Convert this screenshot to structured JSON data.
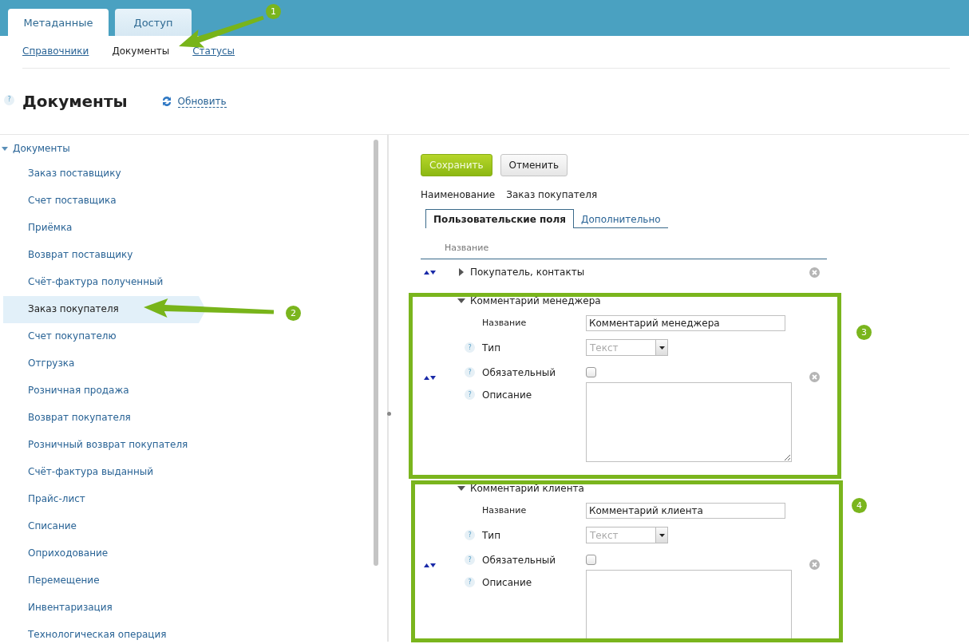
{
  "top_tabs": [
    {
      "label": "Метаданные",
      "selected": true
    },
    {
      "label": "Доступ",
      "selected": false
    }
  ],
  "subnav": [
    {
      "label": "Справочники",
      "selected": false
    },
    {
      "label": "Документы",
      "selected": true
    },
    {
      "label": "Статусы",
      "selected": false
    }
  ],
  "page": {
    "help": "?",
    "title": "Документы",
    "refresh": "Обновить"
  },
  "tree": {
    "label": "Документы",
    "expanded": true,
    "children": [
      {
        "label": "Заказ поставщику",
        "selected": false
      },
      {
        "label": "Счет поставщика",
        "selected": false
      },
      {
        "label": "Приёмка",
        "selected": false
      },
      {
        "label": "Возврат поставщику",
        "selected": false
      },
      {
        "label": "Счёт-фактура полученный",
        "selected": false
      },
      {
        "label": "Заказ покупателя",
        "selected": true
      },
      {
        "label": "Счет покупателю",
        "selected": false
      },
      {
        "label": "Отгрузка",
        "selected": false
      },
      {
        "label": "Розничная продажа",
        "selected": false
      },
      {
        "label": "Возврат покупателя",
        "selected": false
      },
      {
        "label": "Розничный возврат покупателя",
        "selected": false
      },
      {
        "label": "Счёт-фактура выданный",
        "selected": false
      },
      {
        "label": "Прайс-лист",
        "selected": false
      },
      {
        "label": "Списание",
        "selected": false
      },
      {
        "label": "Оприходование",
        "selected": false
      },
      {
        "label": "Перемещение",
        "selected": false
      },
      {
        "label": "Инвентаризация",
        "selected": false
      },
      {
        "label": "Технологическая операция",
        "selected": false
      }
    ]
  },
  "editor": {
    "buttons": [
      {
        "label": "Сохранить",
        "kind": "primary"
      },
      {
        "label": "Отменить",
        "kind": "secondary"
      }
    ],
    "name_label": "Наименование",
    "name_value": "Заказ покупателя",
    "tabs": [
      {
        "label": "Пользовательские поля",
        "selected": true
      },
      {
        "label": "Дополнительно",
        "selected": false
      }
    ],
    "column": "Название",
    "fields": [
      {
        "title": "Покупатель, контакты",
        "expanded": false
      },
      {
        "title": "Комментарий менеджера",
        "expanded": true,
        "rows": [
          {
            "kind": "text",
            "label": "Название",
            "value": "Комментарий менеджера"
          },
          {
            "kind": "select",
            "label": "Тип",
            "value": "Текст",
            "help": "?"
          },
          {
            "kind": "checkbox",
            "label": "Обязательный",
            "checked": false,
            "help": "?"
          },
          {
            "kind": "textarea",
            "label": "Описание",
            "help": "?"
          }
        ]
      },
      {
        "title": "Комментарий клиента",
        "expanded": true,
        "rows": [
          {
            "kind": "text",
            "label": "Название",
            "value": "Комментарий клиента"
          },
          {
            "kind": "select",
            "label": "Тип",
            "value": "Текст",
            "help": "?"
          },
          {
            "kind": "checkbox",
            "label": "Обязательный",
            "checked": false,
            "help": "?"
          },
          {
            "kind": "textarea",
            "label": "Описание",
            "help": "?"
          }
        ]
      }
    ]
  },
  "annotations": [
    {
      "label": "1"
    },
    {
      "label": "2"
    },
    {
      "label": "3"
    },
    {
      "label": "4"
    }
  ]
}
